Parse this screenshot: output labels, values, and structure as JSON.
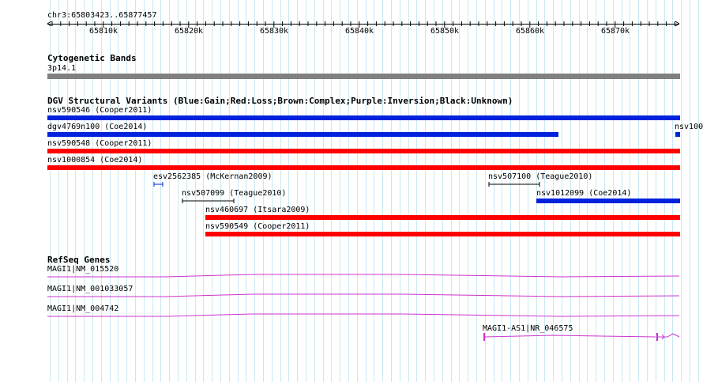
{
  "colors": {
    "gridline": "#c9e8f5",
    "gain": "#0022dd",
    "loss": "#ff0000",
    "gene": "#cc33cc",
    "band": "#808080",
    "text": "#000000"
  },
  "ruler": {
    "position": "chr3:65803423..65877457",
    "ticks": [
      "65810k",
      "65820k",
      "65830k",
      "65840k",
      "65850k",
      "65860k",
      "65870k"
    ]
  },
  "cytobands": {
    "title": "Cytogenetic Bands",
    "band_label": "3p14.1"
  },
  "dgv": {
    "title": "DGV Structural Variants (Blue:Gain;Red:Loss;Brown:Complex;Purple:Inversion;Black:Unknown)",
    "variants": [
      {
        "label": "nsv590546 (Cooper2011)",
        "color": "blue"
      },
      {
        "label": "dgv4769n100 (Coe2014)",
        "color": "blue"
      },
      {
        "label": "nsv100",
        "color": "blue"
      },
      {
        "label": "nsv590548 (Cooper2011)",
        "color": "red"
      },
      {
        "label": "nsv1000854 (Coe2014)",
        "color": "red"
      },
      {
        "label": "esv2562385 (McKernan2009)",
        "color": "blue"
      },
      {
        "label": "nsv507100 (Teague2010)",
        "color": "black"
      },
      {
        "label": "nsv507099 (Teague2010)",
        "color": "black"
      },
      {
        "label": "nsv1012099 (Coe2014)",
        "color": "blue"
      },
      {
        "label": "nsv460697 (Itsara2009)",
        "color": "red"
      },
      {
        "label": "nsv590549 (Cooper2011)",
        "color": "red"
      }
    ]
  },
  "refseq": {
    "title": "RefSeq Genes",
    "genes": [
      {
        "label": "MAGI1|NM_015520"
      },
      {
        "label": "MAGI1|NM_001033057"
      },
      {
        "label": "MAGI1|NM_004742"
      },
      {
        "label": "MAGI1-AS1|NR_046575"
      }
    ]
  }
}
